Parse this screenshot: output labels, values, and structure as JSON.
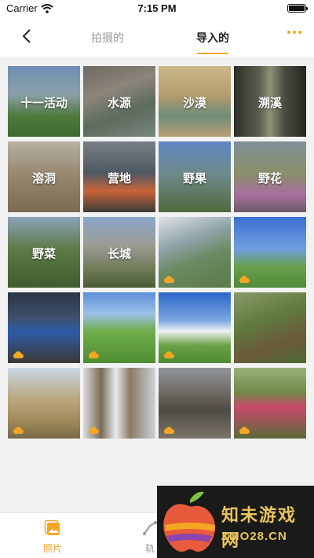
{
  "status_bar": {
    "carrier": "Carrier",
    "time": "7:15 PM"
  },
  "nav": {
    "tab_shot": "拍摄的",
    "tab_imported": "导入的",
    "active_tab": "导入的",
    "accent_color": "#f5a623"
  },
  "folders": [
    {
      "label": "十一活动"
    },
    {
      "label": "水源"
    },
    {
      "label": "沙漠"
    },
    {
      "label": "溯溪"
    },
    {
      "label": "溶洞"
    },
    {
      "label": "营地"
    },
    {
      "label": "野果"
    },
    {
      "label": "野花"
    },
    {
      "label": "野菜"
    },
    {
      "label": "长城"
    }
  ],
  "photos": [
    {
      "scene": "waterfall-stream",
      "cloud": true
    },
    {
      "scene": "hikers-on-meadow",
      "cloud": true
    },
    {
      "scene": "tent-at-sunset",
      "cloud": true
    },
    {
      "scene": "grassland-trail",
      "cloud": true
    },
    {
      "scene": "meadow-blue-sky",
      "cloud": true
    },
    {
      "scene": "forest-undergrowth",
      "cloud": false
    },
    {
      "scene": "winter-hills",
      "cloud": true
    },
    {
      "scene": "icicles",
      "cloud": true
    },
    {
      "scene": "great-wall-ruin",
      "cloud": true
    },
    {
      "scene": "hikers-in-woods",
      "cloud": true
    }
  ],
  "tab_bar": {
    "photos_label": "照片",
    "track_label": "轨"
  },
  "watermark": {
    "title": "知未游戏网",
    "url": "ZMO28.CN"
  }
}
